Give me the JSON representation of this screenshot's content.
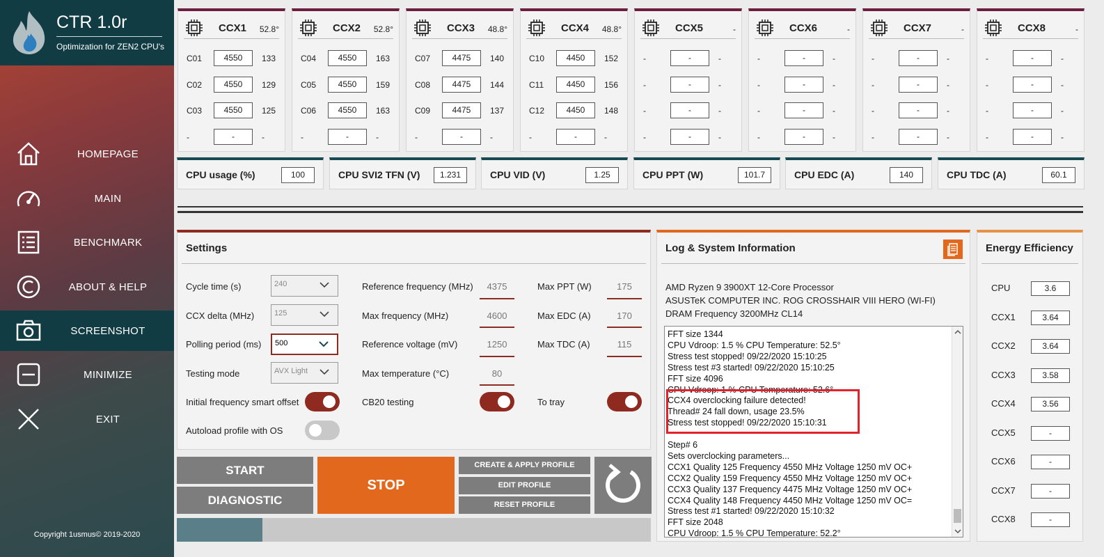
{
  "brand": {
    "title": "CTR 1.0r",
    "subtitle": "Optimization for ZEN2 CPU's"
  },
  "nav": [
    {
      "label": "HOMEPAGE",
      "icon": "home-icon"
    },
    {
      "label": "MAIN",
      "icon": "gauge-icon"
    },
    {
      "label": "BENCHMARK",
      "icon": "list-icon"
    },
    {
      "label": "ABOUT & HELP",
      "icon": "copyright-icon"
    },
    {
      "label": "SCREENSHOT",
      "icon": "camera-icon",
      "active": true
    },
    {
      "label": "MINIMIZE",
      "icon": "minimize-icon"
    },
    {
      "label": "EXIT",
      "icon": "close-icon"
    }
  ],
  "copyright": "Copyright 1usmus© 2019-2020",
  "ccx": [
    {
      "name": "CCX1",
      "temp": "52.8°",
      "cores": [
        {
          "id": "C01",
          "freq": "4550",
          "q": "133"
        },
        {
          "id": "C02",
          "freq": "4550",
          "q": "129"
        },
        {
          "id": "C03",
          "freq": "4550",
          "q": "125"
        },
        {
          "id": "-",
          "freq": "-",
          "q": "-"
        }
      ]
    },
    {
      "name": "CCX2",
      "temp": "52.8°",
      "cores": [
        {
          "id": "C04",
          "freq": "4550",
          "q": "163"
        },
        {
          "id": "C05",
          "freq": "4550",
          "q": "159"
        },
        {
          "id": "C06",
          "freq": "4550",
          "q": "163"
        },
        {
          "id": "-",
          "freq": "-",
          "q": "-"
        }
      ]
    },
    {
      "name": "CCX3",
      "temp": "48.8°",
      "cores": [
        {
          "id": "C07",
          "freq": "4475",
          "q": "140"
        },
        {
          "id": "C08",
          "freq": "4475",
          "q": "144"
        },
        {
          "id": "C09",
          "freq": "4475",
          "q": "137"
        },
        {
          "id": "-",
          "freq": "-",
          "q": "-"
        }
      ]
    },
    {
      "name": "CCX4",
      "temp": "48.8°",
      "cores": [
        {
          "id": "C10",
          "freq": "4450",
          "q": "152"
        },
        {
          "id": "C11",
          "freq": "4450",
          "q": "156"
        },
        {
          "id": "C12",
          "freq": "4450",
          "q": "148"
        },
        {
          "id": "-",
          "freq": "-",
          "q": "-"
        }
      ]
    },
    {
      "name": "CCX5",
      "temp": "-",
      "cores": [
        {
          "id": "-",
          "freq": "-",
          "q": "-"
        },
        {
          "id": "-",
          "freq": "-",
          "q": "-"
        },
        {
          "id": "-",
          "freq": "-",
          "q": "-"
        },
        {
          "id": "-",
          "freq": "-",
          "q": "-"
        }
      ]
    },
    {
      "name": "CCX6",
      "temp": "-",
      "cores": [
        {
          "id": "-",
          "freq": "-",
          "q": "-"
        },
        {
          "id": "-",
          "freq": "-",
          "q": "-"
        },
        {
          "id": "-",
          "freq": "-",
          "q": "-"
        },
        {
          "id": "-",
          "freq": "-",
          "q": "-"
        }
      ]
    },
    {
      "name": "CCX7",
      "temp": "-",
      "cores": [
        {
          "id": "-",
          "freq": "-",
          "q": "-"
        },
        {
          "id": "-",
          "freq": "-",
          "q": "-"
        },
        {
          "id": "-",
          "freq": "-",
          "q": "-"
        },
        {
          "id": "-",
          "freq": "-",
          "q": "-"
        }
      ]
    },
    {
      "name": "CCX8",
      "temp": "-",
      "cores": [
        {
          "id": "-",
          "freq": "-",
          "q": "-"
        },
        {
          "id": "-",
          "freq": "-",
          "q": "-"
        },
        {
          "id": "-",
          "freq": "-",
          "q": "-"
        },
        {
          "id": "-",
          "freq": "-",
          "q": "-"
        }
      ]
    }
  ],
  "stats": [
    {
      "label": "CPU usage (%)",
      "value": "100"
    },
    {
      "label": "CPU SVI2 TFN (V)",
      "value": "1.231"
    },
    {
      "label": "CPU VID (V)",
      "value": "1.25"
    },
    {
      "label": "CPU PPT (W)",
      "value": "101.7"
    },
    {
      "label": "CPU EDC (A)",
      "value": "140"
    },
    {
      "label": "CPU TDC (A)",
      "value": "60.1"
    }
  ],
  "settings": {
    "title": "Settings",
    "cycle_time": {
      "label": "Cycle time (s)",
      "value": "240"
    },
    "ccx_delta": {
      "label": "CCX delta (MHz)",
      "value": "125"
    },
    "polling": {
      "label": "Polling period (ms)",
      "value": "500"
    },
    "testing_mode": {
      "label": "Testing mode",
      "value": "AVX Light"
    },
    "initial_offset": {
      "label": "Initial frequency smart offset",
      "on": true
    },
    "autoload": {
      "label": "Autoload profile with OS",
      "on": false
    },
    "ref_freq": {
      "label": "Reference frequency (MHz)",
      "value": "4375"
    },
    "max_freq": {
      "label": "Max frequency (MHz)",
      "value": "4600"
    },
    "ref_volt": {
      "label": "Reference voltage (mV)",
      "value": "1250"
    },
    "max_temp": {
      "label": "Max temperature (°C)",
      "value": "80"
    },
    "cb20": {
      "label": "CB20 testing",
      "on": true
    },
    "max_ppt": {
      "label": "Max PPT (W)",
      "value": "175"
    },
    "max_edc": {
      "label": "Max EDC (A)",
      "value": "170"
    },
    "max_tdc": {
      "label": "Max TDC (A)",
      "value": "115"
    },
    "to_tray": {
      "label": "To tray",
      "on": true
    }
  },
  "buttons": {
    "start": "START",
    "diagnostic": "DIAGNOSTIC",
    "stop": "STOP",
    "create_apply": "CREATE & APPLY PROFILE",
    "edit": "EDIT PROFILE",
    "reset": "RESET PROFILE"
  },
  "progress": 0.18,
  "log": {
    "title": "Log & System Information",
    "cpu": "AMD Ryzen 9 3900XT 12-Core Processor",
    "board": "ASUSTeK COMPUTER INC. ROG CROSSHAIR VIII HERO (WI-FI)",
    "dram": "DRAM Frequency 3200MHz CL14",
    "lines": [
      "FFT size 1344",
      "CPU Vdroop: 1.5 %  CPU Temperature: 52.5°",
      "Stress test stopped!  09/22/2020 15:10:25",
      "Stress test #3 started!  09/22/2020 15:10:25",
      "FFT size 4096",
      "CPU Vdroop: 1 %  CPU Temperature: 52.6°",
      "CCX4 overclocking failure detected!",
      "Thread# 24 fall down, usage 23.5%",
      "Stress test stopped!  09/22/2020 15:10:31",
      "",
      "Step# 6",
      "Sets overclocking parameters...",
      "CCX1  Quality 125  Frequency 4550 MHz  Voltage 1250 mV  OC+",
      "CCX2  Quality 159  Frequency 4550 MHz  Voltage 1250 mV  OC+",
      "CCX3  Quality 137  Frequency 4475 MHz  Voltage 1250 mV  OC+",
      "CCX4  Quality 148  Frequency 4450 MHz  Voltage 1250 mV  OC=",
      "Stress test #1 started!  09/22/2020 15:10:32",
      "FFT size 2048",
      "CPU Vdroop: 1.5 %  CPU Temperature: 52.2°"
    ]
  },
  "energy": {
    "title": "Energy Efficiency",
    "items": [
      {
        "label": "CPU",
        "value": "3.6"
      },
      {
        "label": "CCX1",
        "value": "3.64"
      },
      {
        "label": "CCX2",
        "value": "3.64"
      },
      {
        "label": "CCX3",
        "value": "3.58"
      },
      {
        "label": "CCX4",
        "value": "3.56"
      },
      {
        "label": "CCX5",
        "value": "-"
      },
      {
        "label": "CCX6",
        "value": "-"
      },
      {
        "label": "CCX7",
        "value": "-"
      },
      {
        "label": "CCX8",
        "value": "-"
      }
    ]
  },
  "colors": {
    "sidebar_dark": "#123c44",
    "accent_orange": "#e2681e",
    "accent_red": "#8e2a20",
    "ccx_header": "#6b1e3d",
    "stat_header": "#164a52"
  }
}
